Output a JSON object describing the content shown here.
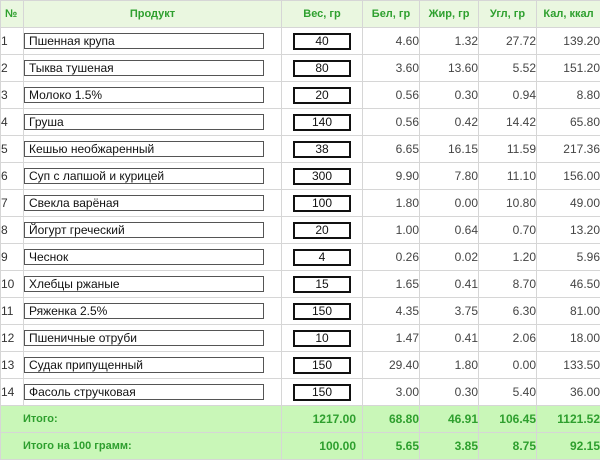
{
  "colors": {
    "header_bg": "#eaf7e0",
    "header_text": "#2fa02f",
    "footer_bg": "#c9f7b8",
    "footer_text": "#2e9f2e"
  },
  "headers": {
    "num": "№",
    "product": "Продукт",
    "weight": "Вес, гр",
    "protein": "Бел, гр",
    "fat": "Жир, гр",
    "carbs": "Угл, гр",
    "kcal": "Кал, ккал"
  },
  "rows": [
    {
      "num": "1",
      "product": "Пшенная крупа",
      "weight": "40",
      "protein": "4.60",
      "fat": "1.32",
      "carbs": "27.72",
      "kcal": "139.20"
    },
    {
      "num": "2",
      "product": "Тыква тушеная",
      "weight": "80",
      "protein": "3.60",
      "fat": "13.60",
      "carbs": "5.52",
      "kcal": "151.20"
    },
    {
      "num": "3",
      "product": "Молоко 1.5%",
      "weight": "20",
      "protein": "0.56",
      "fat": "0.30",
      "carbs": "0.94",
      "kcal": "8.80"
    },
    {
      "num": "4",
      "product": "Груша",
      "weight": "140",
      "protein": "0.56",
      "fat": "0.42",
      "carbs": "14.42",
      "kcal": "65.80"
    },
    {
      "num": "5",
      "product": "Кешью необжаренный",
      "weight": "38",
      "protein": "6.65",
      "fat": "16.15",
      "carbs": "11.59",
      "kcal": "217.36"
    },
    {
      "num": "6",
      "product": "Суп с лапшой и курицей",
      "weight": "300",
      "protein": "9.90",
      "fat": "7.80",
      "carbs": "11.10",
      "kcal": "156.00"
    },
    {
      "num": "7",
      "product": "Свекла варёная",
      "weight": "100",
      "protein": "1.80",
      "fat": "0.00",
      "carbs": "10.80",
      "kcal": "49.00"
    },
    {
      "num": "8",
      "product": "Йогурт греческий",
      "weight": "20",
      "protein": "1.00",
      "fat": "0.64",
      "carbs": "0.70",
      "kcal": "13.20"
    },
    {
      "num": "9",
      "product": "Чеснок",
      "weight": "4",
      "protein": "0.26",
      "fat": "0.02",
      "carbs": "1.20",
      "kcal": "5.96"
    },
    {
      "num": "10",
      "product": "Хлебцы ржаные",
      "weight": "15",
      "protein": "1.65",
      "fat": "0.41",
      "carbs": "8.70",
      "kcal": "46.50"
    },
    {
      "num": "11",
      "product": "Ряженка 2.5%",
      "weight": "150",
      "protein": "4.35",
      "fat": "3.75",
      "carbs": "6.30",
      "kcal": "81.00"
    },
    {
      "num": "12",
      "product": "Пшеничные отруби",
      "weight": "10",
      "protein": "1.47",
      "fat": "0.41",
      "carbs": "2.06",
      "kcal": "18.00"
    },
    {
      "num": "13",
      "product": "Судак припущенный",
      "weight": "150",
      "protein": "29.40",
      "fat": "1.80",
      "carbs": "0.00",
      "kcal": "133.50"
    },
    {
      "num": "14",
      "product": "Фасоль стручковая",
      "weight": "150",
      "protein": "3.00",
      "fat": "0.30",
      "carbs": "5.40",
      "kcal": "36.00"
    }
  ],
  "totals": {
    "label": "Итого:",
    "weight": "1217.00",
    "protein": "68.80",
    "fat": "46.91",
    "carbs": "106.45",
    "kcal": "1121.52"
  },
  "per100": {
    "label": "Итого на 100 грамм:",
    "weight": "100.00",
    "protein": "5.65",
    "fat": "3.85",
    "carbs": "8.75",
    "kcal": "92.15"
  }
}
